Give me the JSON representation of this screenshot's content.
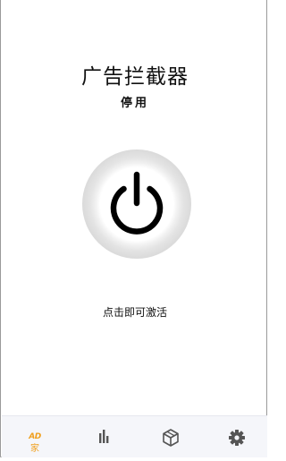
{
  "app": {
    "title": "广告拦截器",
    "status": "停用",
    "hint": "点击即可激活"
  },
  "power_button": {
    "icon": "power-icon",
    "state": "off"
  },
  "tabs": [
    {
      "id": "home",
      "icon": "ad-icon",
      "icon_text": "AD",
      "label": "家",
      "active": true
    },
    {
      "id": "stats",
      "icon": "bar-chart-icon",
      "active": false
    },
    {
      "id": "packages",
      "icon": "package-box-icon",
      "active": false
    },
    {
      "id": "settings",
      "icon": "gear-icon",
      "active": false
    }
  ],
  "colors": {
    "accent": "#f0a020",
    "tab_inactive": "#555555",
    "tabbar_bg": "#f5f6fa",
    "ring": "#dadada"
  }
}
